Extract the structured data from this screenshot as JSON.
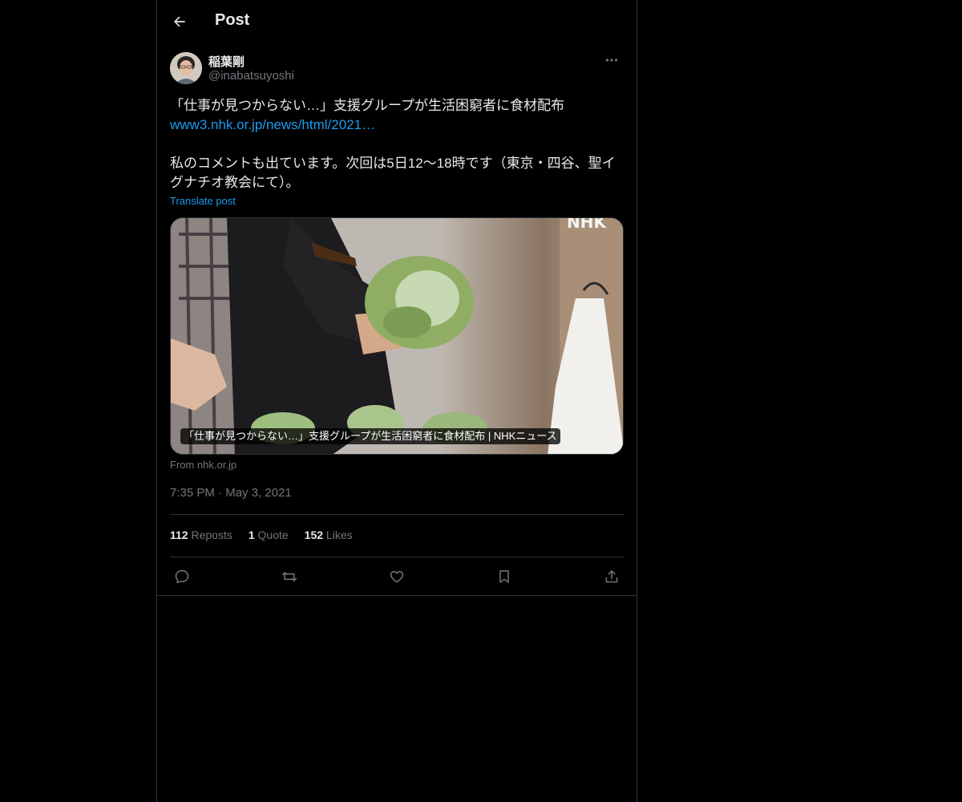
{
  "header": {
    "title": "Post",
    "back_icon": "arrow-left-icon"
  },
  "post": {
    "author": {
      "display_name": "稲葉剛",
      "handle": "@inabatsuyoshi"
    },
    "text": {
      "line1": "「仕事が見つからない…」支援グループが生活困窮者に食材配布",
      "link": "www3.nhk.or.jp/news/html/2021…",
      "line3": "私のコメントも出ています。次回は5日12〜18時です（東京・四谷、聖イ",
      "line4": "グナチオ教会にて）。"
    },
    "translate_label": "Translate post",
    "card": {
      "caption": "「仕事が見つからない…」支援グループが生活困窮者に食材配布 | NHKニュース",
      "watermark": "NHK",
      "source": "From nhk.or.jp"
    },
    "time": "7:35 PM",
    "separator": "·",
    "date": "May 3, 2021",
    "stats": {
      "reposts_count": "112",
      "reposts_label": "Reposts",
      "quotes_count": "1",
      "quotes_label": "Quote",
      "likes_count": "152",
      "likes_label": "Likes"
    },
    "actions": [
      "reply-icon",
      "repost-icon",
      "like-icon",
      "bookmark-icon",
      "share-icon"
    ]
  },
  "colors": {
    "background": "#000000",
    "text": "#e7e9ea",
    "secondary": "#71767b",
    "accent": "#1d9bf0",
    "border": "#2f3336"
  }
}
